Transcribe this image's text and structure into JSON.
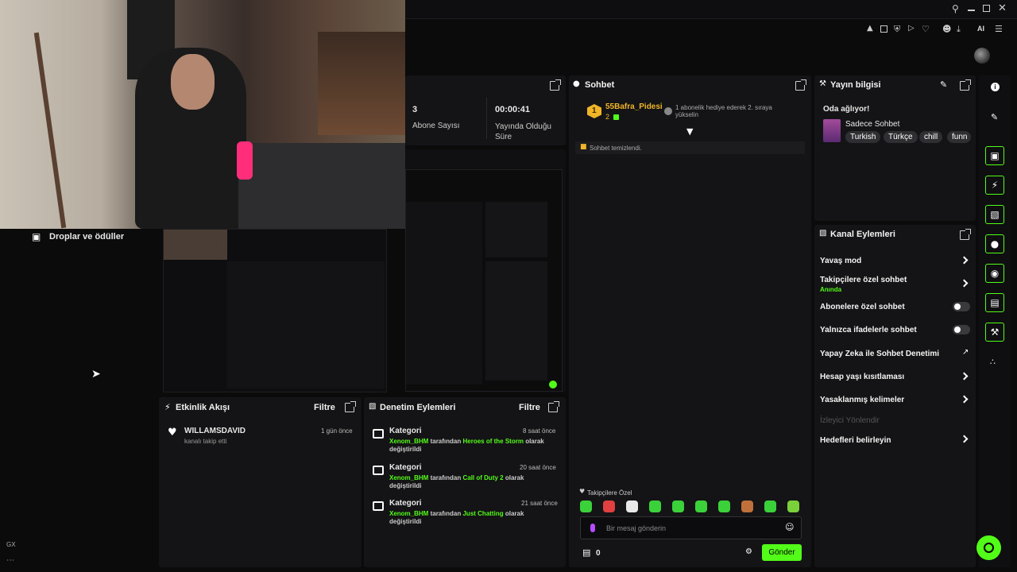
{
  "browser": {
    "toolbar_icons": [
      "search-icon",
      "minimize-icon",
      "restore-icon",
      "close-icon"
    ],
    "ext_icons": [
      "pin-icon",
      "snapshot-icon",
      "shield-icon",
      "play-icon",
      "heart-icon",
      "account-icon",
      "download-icon"
    ],
    "ai_label": "AI",
    "gx_label": "GX"
  },
  "stats": {
    "subs_value": "3",
    "subs_label": "Abone Sayısı",
    "uptime_value": "00:00:41",
    "uptime_label": "Yayında Olduğu Süre"
  },
  "drops": {
    "title": "Droplar ve ödüller"
  },
  "chat": {
    "title": "Sohbet",
    "top_gifter_rank": "1",
    "top_gifter_name": "55Bafra_Pidesi",
    "top_gifter_count": "2",
    "promo_text": "1 abonelik hediye ederek 2. sıraya yükselin",
    "cleared_text": "Sohbet temizlendi.",
    "followers_only_label": "Takipçilere Özel",
    "input_placeholder": "Bir mesaj gönderin",
    "points": "0",
    "send_label": "Gönder",
    "emote_colors": [
      "#3ad13a",
      "#e04040",
      "#e8e8e8",
      "#3ad13a",
      "#3ad13a",
      "#3ad13a",
      "#3ad13a",
      "#c0703a",
      "#3ad13a",
      "#7ad13a"
    ]
  },
  "stream_info": {
    "title": "Yayın bilgisi",
    "room_text": "Oda ağlıyor!",
    "category": "Sadece Sohbet",
    "tags": [
      "Turkish",
      "Türkçe",
      "chill",
      "funn"
    ]
  },
  "channel_actions": {
    "title": "Kanal Eylemleri",
    "slow_mode": "Yavaş mod",
    "followers_chat": "Takipçilere özel sohbet",
    "followers_chat_sub": "Anında",
    "subs_chat": "Abonelere özel sohbet",
    "emotes_chat": "Yalnızca ifadelerle sohbet",
    "ai_moderation": "Yapay Zeka ile Sohbet Denetimi",
    "account_age": "Hesap yaşı kısıtlaması",
    "banned_words": "Yasaklanmış kelimeler",
    "raid_viewer": "İzleyici Yönlendir",
    "set_goals": "Hedefleri belirleyin"
  },
  "activity": {
    "title": "Etkinlik Akışı",
    "filter": "Filtre",
    "items": [
      {
        "user": "WILLAMSDAVID",
        "action": "kanalı takip etti",
        "time": "1 gün önce"
      }
    ]
  },
  "moderation": {
    "title": "Denetim Eylemleri",
    "filter": "Filtre",
    "items": [
      {
        "kind": "Kategori",
        "time": "8 saat önce",
        "user": "Xenom_BHM",
        "mid": "tarafından",
        "target": "Heroes of the Storm",
        "end1": "olarak",
        "end2": "değiştirildi"
      },
      {
        "kind": "Kategori",
        "time": "20 saat önce",
        "user": "Xenom_BHM",
        "mid": "tarafından",
        "target": "Call of Duty 2",
        "end1": "olarak",
        "end2": "değiştirildi"
      },
      {
        "kind": "Kategori",
        "time": "21 saat önce",
        "user": "Xenom_BHM",
        "mid": "tarafından",
        "target": "Just Chatting",
        "end1": "olarak",
        "end2": "değiştirildi"
      }
    ]
  },
  "side_rail": [
    "info-icon",
    "edit-icon",
    "screenshot-icon",
    "lightning-icon",
    "notes-icon",
    "chat-icon",
    "broadcast-icon",
    "moderation-icon",
    "wrench-icon",
    "bubbles-icon"
  ]
}
